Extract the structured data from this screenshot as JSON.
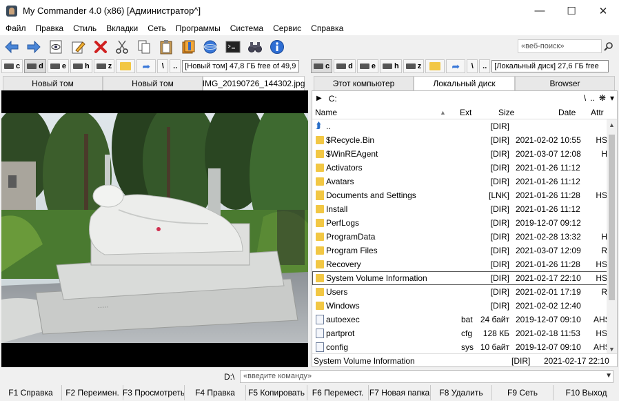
{
  "window": {
    "title": "My Commander 4.0 (x86) [Администратор^]",
    "minimize": "—",
    "maximize": "☐",
    "close": "✕"
  },
  "menu": [
    "Файл",
    "Правка",
    "Стиль",
    "Вкладки",
    "Сеть",
    "Программы",
    "Система",
    "Сервис",
    "Справка"
  ],
  "toolbar": {
    "icons": [
      "back-arrow-icon",
      "forward-arrow-icon",
      "view-icon",
      "edit-icon",
      "delete-icon",
      "cut-icon",
      "copy-icon",
      "paste-icon",
      "archive-icon",
      "network-icon",
      "terminal-icon",
      "binoculars-icon",
      "info-icon"
    ],
    "web_search_placeholder": "«веб-поиск»"
  },
  "left_drives": {
    "drives": [
      {
        "letter": "c",
        "active": false
      },
      {
        "letter": "d",
        "active": true
      },
      {
        "letter": "e",
        "active": false
      },
      {
        "letter": "h",
        "active": false
      },
      {
        "letter": "z",
        "active": false
      }
    ],
    "root": "\\",
    "up": "..",
    "info": "[Новый том] 47,8 ГБ free of 49,9"
  },
  "right_drives": {
    "drives": [
      {
        "letter": "c",
        "active": true
      },
      {
        "letter": "d",
        "active": false
      },
      {
        "letter": "e",
        "active": false
      },
      {
        "letter": "h",
        "active": false
      },
      {
        "letter": "z",
        "active": false
      }
    ],
    "root": "\\",
    "up": "..",
    "info": "[Локальный диск] 27,6 ГБ free"
  },
  "left_tabs": [
    "Новый том",
    "Новый том",
    "IMG_20190726_144302.jpg"
  ],
  "right_tabs": [
    "Этот компьютер",
    "Локальный диск",
    "Browser"
  ],
  "right_panel": {
    "path": "C:",
    "path_tools": [
      "\\",
      "..",
      "❋",
      "▾"
    ],
    "columns": {
      "name": "Name",
      "ext": "Ext",
      "size": "Size",
      "date": "Date",
      "attr": "Attr"
    },
    "sort_marker": "▲",
    "rows": [
      {
        "icon": "up",
        "name": "..",
        "ext": "",
        "size": "[DIR]",
        "date": "",
        "attr": ""
      },
      {
        "icon": "folder",
        "name": "$Recycle.Bin",
        "ext": "",
        "size": "[DIR]",
        "date": "2021-02-02 10:55",
        "attr": "HS"
      },
      {
        "icon": "folder",
        "name": "$WinREAgent",
        "ext": "",
        "size": "[DIR]",
        "date": "2021-03-07 12:08",
        "attr": "H"
      },
      {
        "icon": "folder",
        "name": "Activators",
        "ext": "",
        "size": "[DIR]",
        "date": "2021-01-26 11:12",
        "attr": ""
      },
      {
        "icon": "folder",
        "name": "Avatars",
        "ext": "",
        "size": "[DIR]",
        "date": "2021-01-26 11:12",
        "attr": ""
      },
      {
        "icon": "lnk",
        "name": "Documents and Settings",
        "ext": "",
        "size": "[LNK]",
        "date": "2021-01-26 11:28",
        "attr": "HS"
      },
      {
        "icon": "folder",
        "name": "Install",
        "ext": "",
        "size": "[DIR]",
        "date": "2021-01-26 11:12",
        "attr": ""
      },
      {
        "icon": "folder",
        "name": "PerfLogs",
        "ext": "",
        "size": "[DIR]",
        "date": "2019-12-07 09:12",
        "attr": ""
      },
      {
        "icon": "folder",
        "name": "ProgramData",
        "ext": "",
        "size": "[DIR]",
        "date": "2021-02-28 13:32",
        "attr": "H"
      },
      {
        "icon": "folder",
        "name": "Program Files",
        "ext": "",
        "size": "[DIR]",
        "date": "2021-03-07 12:09",
        "attr": "R"
      },
      {
        "icon": "folder",
        "name": "Recovery",
        "ext": "",
        "size": "[DIR]",
        "date": "2021-01-26 11:28",
        "attr": "HS"
      },
      {
        "icon": "folder",
        "name": "System Volume Information",
        "ext": "",
        "size": "[DIR]",
        "date": "2021-02-17 22:10",
        "attr": "HS",
        "selected": true
      },
      {
        "icon": "folder",
        "name": "Users",
        "ext": "",
        "size": "[DIR]",
        "date": "2021-02-01 17:19",
        "attr": "R"
      },
      {
        "icon": "folder",
        "name": "Windows",
        "ext": "",
        "size": "[DIR]",
        "date": "2021-02-02 12:40",
        "attr": ""
      },
      {
        "icon": "file",
        "name": "autoexec",
        "ext": "bat",
        "size": "24 байт",
        "date": "2019-12-07 09:10",
        "attr": "AHS"
      },
      {
        "icon": "file",
        "name": "partprot",
        "ext": "cfg",
        "size": "128 КБ",
        "date": "2021-02-18 11:53",
        "attr": "HS"
      },
      {
        "icon": "file",
        "name": "config",
        "ext": "sys",
        "size": "10 байт",
        "date": "2019-12-07 09:10",
        "attr": "AHS"
      }
    ],
    "status": {
      "name": "System Volume Information",
      "size": "[DIR]",
      "date": "2021-02-17 22:10"
    }
  },
  "command_line": {
    "drive": "D:\\",
    "placeholder": "«введите команду»"
  },
  "function_keys": [
    "F1 Справка",
    "F2 Переимен.",
    "F3 Просмотреть",
    "F4 Правка",
    "F5 Копировать",
    "F6 Перемест.",
    "F7 Новая папка",
    "F8 Удалить",
    "F9 Сеть",
    "F10 Выход"
  ]
}
